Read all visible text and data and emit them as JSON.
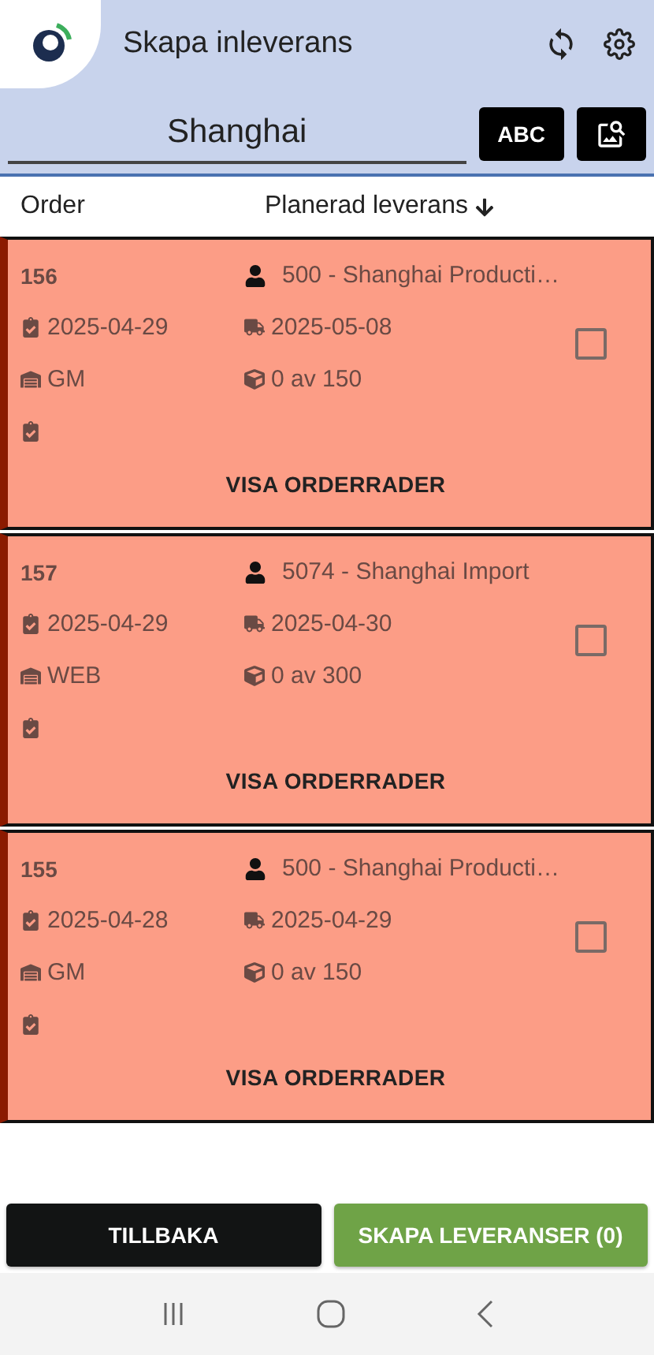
{
  "header": {
    "title": "Skapa inleverans"
  },
  "search": {
    "value": "Shanghai",
    "keyboard_button": "ABC"
  },
  "columns": [
    {
      "label": "Order",
      "sorted": false
    },
    {
      "label": "Planerad leverans",
      "sorted": true
    }
  ],
  "orders": [
    {
      "number": "156",
      "supplier": "500 - Shanghai Producti…",
      "order_date": "2025-04-29",
      "delivery_date": "2025-05-08",
      "warehouse": "GM",
      "quantity": "0 av 150",
      "checked": false,
      "action": "VISA ORDERRADER"
    },
    {
      "number": "157",
      "supplier": "5074 - Shanghai Import",
      "order_date": "2025-04-29",
      "delivery_date": "2025-04-30",
      "warehouse": "WEB",
      "quantity": "0 av 300",
      "checked": false,
      "action": "VISA ORDERRADER"
    },
    {
      "number": "155",
      "supplier": "500 - Shanghai Producti…",
      "order_date": "2025-04-28",
      "delivery_date": "2025-04-29",
      "warehouse": "GM",
      "quantity": "0 av 150",
      "checked": false,
      "action": "VISA ORDERRADER"
    }
  ],
  "buttons": {
    "back": "TILLBAKA",
    "create": "SKAPA LEVERANSER (0)"
  }
}
